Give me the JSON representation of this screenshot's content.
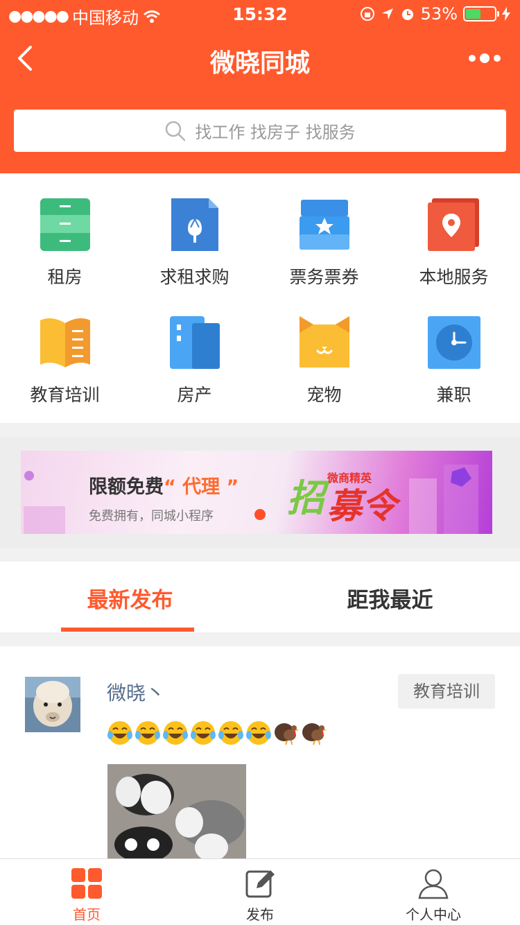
{
  "status_bar": {
    "carrier": "中国移动",
    "time": "15:32",
    "battery": "53%",
    "battery_level": 0.53
  },
  "navbar": {
    "title": "微晓同城"
  },
  "search": {
    "placeholder": "找工作 找房子 找服务"
  },
  "categories": [
    {
      "label": "租房",
      "icon": "drawer-cabinet-icon",
      "color": "#3dbb7d"
    },
    {
      "label": "求租求购",
      "icon": "document-flower-icon",
      "color": "#3b82d6"
    },
    {
      "label": "票务票券",
      "icon": "ticket-box-icon",
      "color": "#3a9bef"
    },
    {
      "label": "本地服务",
      "icon": "location-pin-icon",
      "color": "#f05a3e"
    },
    {
      "label": "教育培训",
      "icon": "open-book-icon",
      "color": "#f6a432"
    },
    {
      "label": "房产",
      "icon": "building-icon",
      "color": "#4aa6f4"
    },
    {
      "label": "宠物",
      "icon": "cat-face-icon",
      "color": "#fbbd33"
    },
    {
      "label": "兼职",
      "icon": "clock-icon",
      "color": "#3d93eb"
    }
  ],
  "banner": {
    "title_prefix": "限额免费",
    "title_highlight": "“ 代理 ”",
    "subtitle": "免费拥有，同城小程序",
    "art_text_small": "微商精英",
    "art_text_big": "招募令"
  },
  "tabs": [
    {
      "label": "最新发布",
      "active": true
    },
    {
      "label": "距我最近",
      "active": false
    }
  ],
  "post": {
    "author": "微晓丶",
    "category_tag": "教育培训",
    "emoji_laugh_count": 6,
    "emoji_turkey_count": 2
  },
  "bottom_nav": [
    {
      "label": "首页",
      "icon": "home-grid-icon",
      "active": true
    },
    {
      "label": "发布",
      "icon": "edit-icon",
      "active": false
    },
    {
      "label": "个人中心",
      "icon": "user-icon",
      "active": false
    }
  ],
  "colors": {
    "brand": "#ff5a2e",
    "link": "#556c8c"
  }
}
